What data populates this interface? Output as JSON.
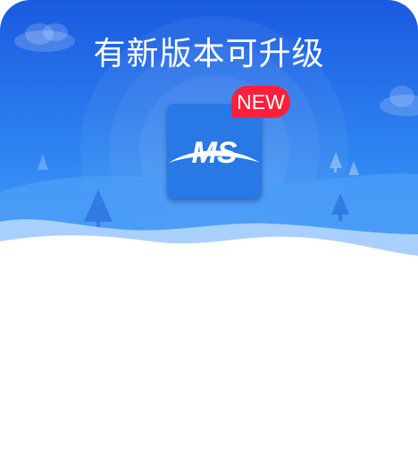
{
  "dialog": {
    "title": "有新版本可升级",
    "badge": "NEW",
    "app_icon": {
      "text": "MS",
      "icon": "app-logo-icon"
    }
  },
  "colors": {
    "header_top": "#1a5fe0",
    "header_bottom": "#3a8cf5",
    "badge": "#ff1f3a",
    "app_icon_bg": "#2878e6",
    "body": "#ffffff"
  }
}
